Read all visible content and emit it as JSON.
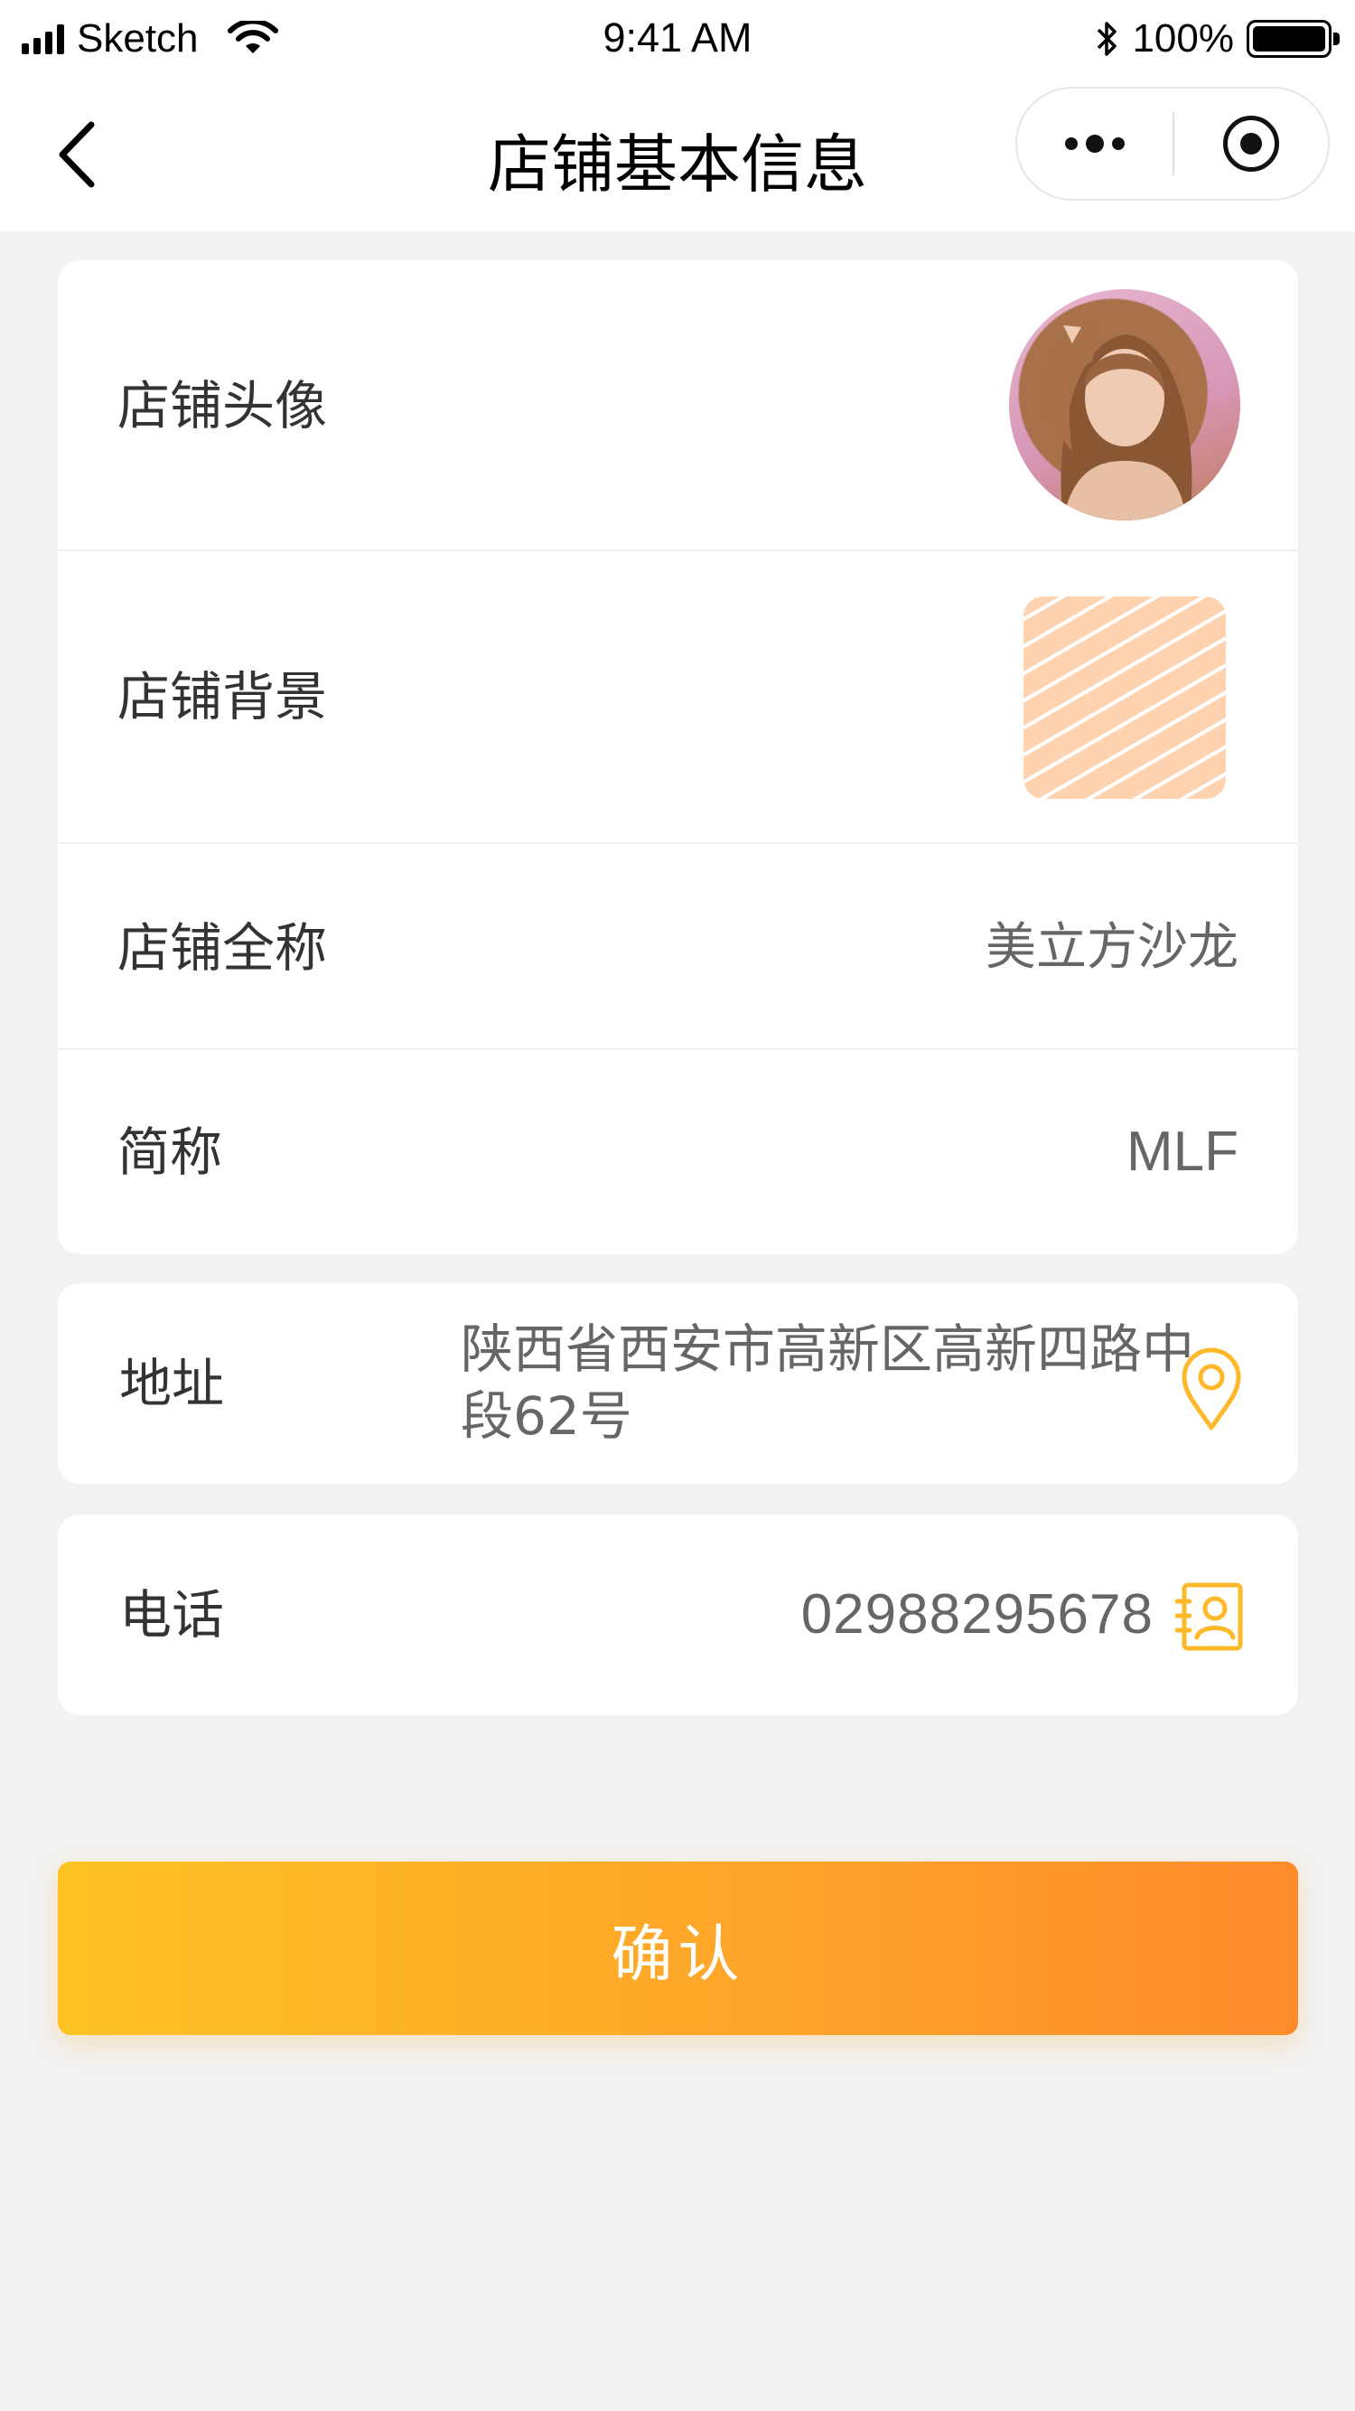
{
  "status_bar": {
    "carrier": "Sketch",
    "time": "9:41 AM",
    "battery_percent": "100%",
    "battery_level": 1.0,
    "icons": [
      "signal-icon",
      "wifi-icon",
      "bluetooth-icon",
      "battery-icon"
    ]
  },
  "nav": {
    "title": "店铺基本信息",
    "back_icon": "chevron-left-icon",
    "more_icon": "more-dots-icon",
    "close_icon": "target-circle-icon"
  },
  "form": {
    "avatar": {
      "label": "店铺头像"
    },
    "background": {
      "label": "店铺背景"
    },
    "full_name": {
      "label": "店铺全称",
      "value": "美立方沙龙"
    },
    "short_name": {
      "label": "简称",
      "value": "MLF"
    },
    "address": {
      "label": "地址",
      "value": "陕西省西安市高新区高新四路中段62号",
      "icon": "location-pin-icon"
    },
    "phone": {
      "label": "电话",
      "value": "02988295678",
      "icon": "contact-card-icon"
    }
  },
  "confirm": {
    "label": "确认"
  },
  "colors": {
    "accent": "#FEC12A",
    "accent_end": "#FE8C2C",
    "page_bg": "#F2F2F2",
    "card_bg": "#FFFFFF",
    "label_text": "#333333",
    "value_text": "#666666"
  }
}
